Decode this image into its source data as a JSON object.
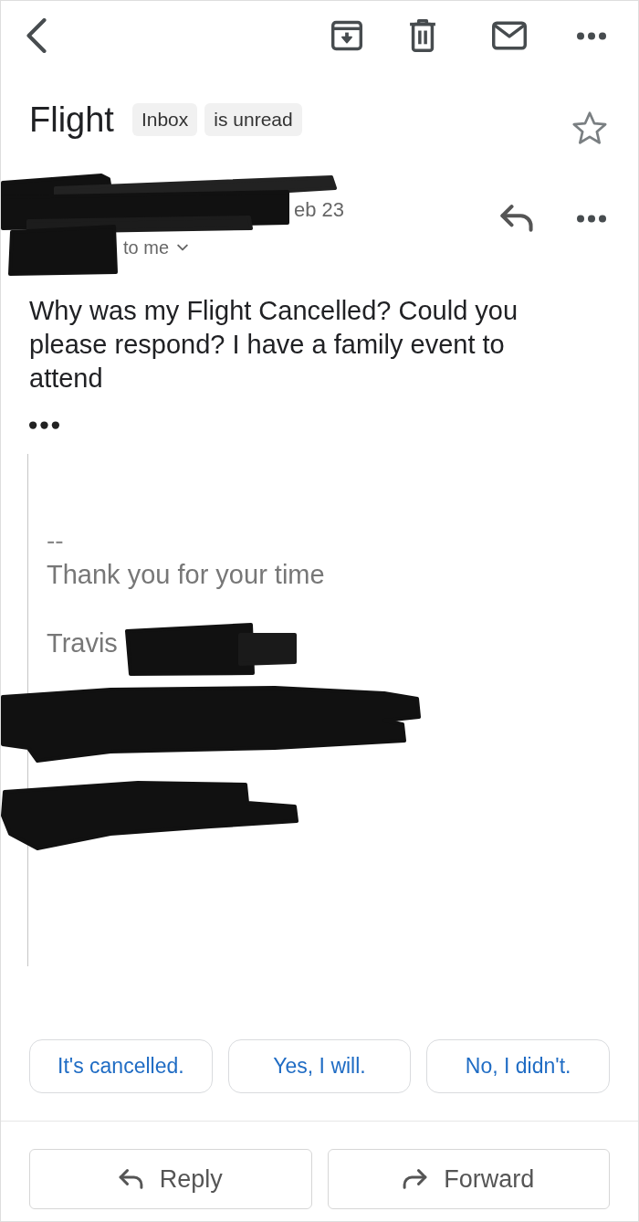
{
  "subject": {
    "title": "Flight",
    "labels": [
      "Inbox",
      "is unread"
    ],
    "starred": false
  },
  "message": {
    "date": "eb 23",
    "recipient": "to me",
    "body": "Why was my Flight Cancelled? Could you please respond? I have a family event to attend",
    "signature": {
      "separator": "--",
      "lines": [
        "Thank you for your time",
        "Travis"
      ]
    }
  },
  "smart_replies": [
    "It's cancelled.",
    "Yes, I will.",
    "No, I didn't."
  ],
  "actions": [
    {
      "kind": "reply",
      "label": "Reply"
    },
    {
      "kind": "forward",
      "label": "Forward"
    }
  ]
}
